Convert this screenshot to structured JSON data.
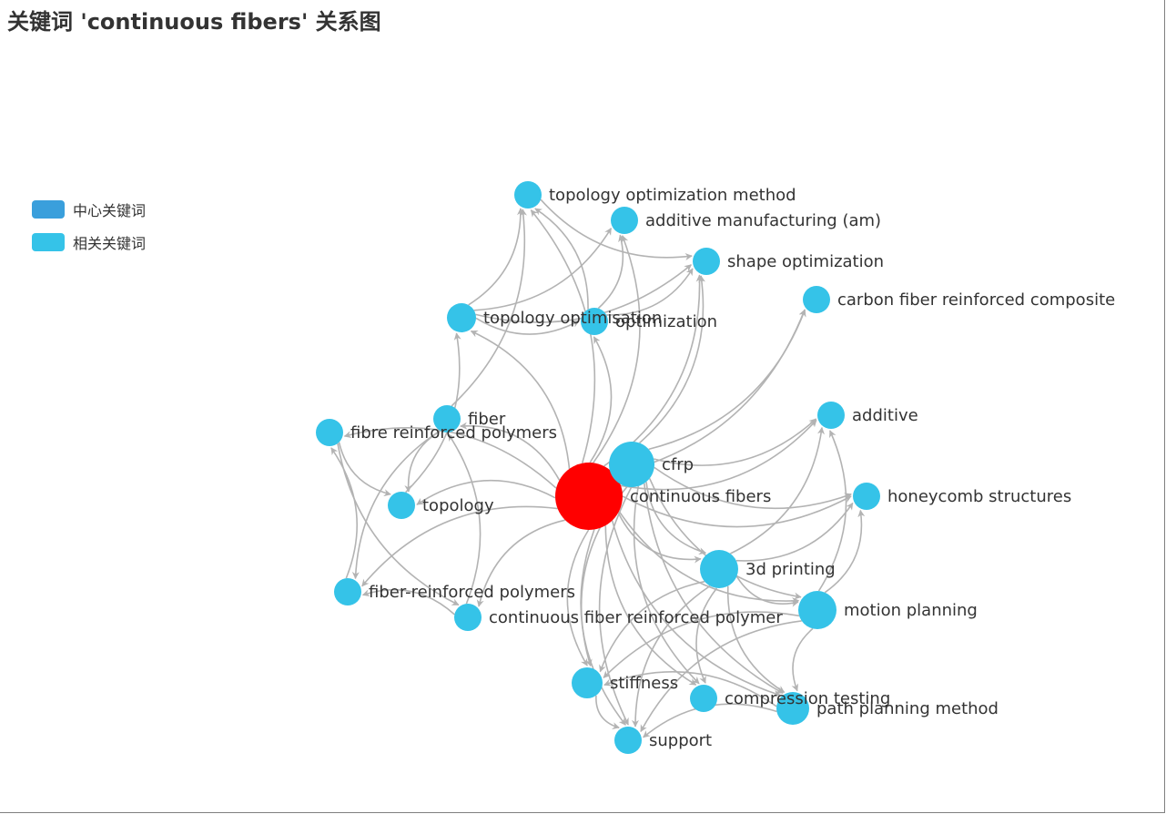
{
  "title": "关键词 'continuous fibers' 关系图",
  "legend": [
    {
      "label": "中心关键词",
      "color": "#3a9fdc"
    },
    {
      "label": "相关关键词",
      "color": "#35c3e8"
    }
  ],
  "colors": {
    "center": "#ff0000",
    "related": "#35c3e8",
    "edge": "#b3b3b3"
  },
  "nodes": [
    {
      "id": "continuous fibers",
      "category": "center"
    },
    {
      "id": "cfrp",
      "category": "related"
    },
    {
      "id": "3d printing",
      "category": "related"
    },
    {
      "id": "motion planning",
      "category": "related"
    },
    {
      "id": "path planning method",
      "category": "related"
    },
    {
      "id": "topology optimization method",
      "category": "related"
    },
    {
      "id": "additive manufacturing (am)",
      "category": "related"
    },
    {
      "id": "shape optimization",
      "category": "related"
    },
    {
      "id": "carbon fiber reinforced composite",
      "category": "related"
    },
    {
      "id": "topology optimisation",
      "category": "related"
    },
    {
      "id": "optimization",
      "category": "related"
    },
    {
      "id": "additive",
      "category": "related"
    },
    {
      "id": "fiber",
      "category": "related"
    },
    {
      "id": "fibre reinforced polymers",
      "category": "related"
    },
    {
      "id": "honeycomb structures",
      "category": "related"
    },
    {
      "id": "topology",
      "category": "related"
    },
    {
      "id": "fiber-reinforced polymers",
      "category": "related"
    },
    {
      "id": "continuous fiber reinforced polymer",
      "category": "related"
    },
    {
      "id": "stiffness",
      "category": "related"
    },
    {
      "id": "compression testing",
      "category": "related"
    },
    {
      "id": "support",
      "category": "related"
    }
  ],
  "edges": [
    [
      "continuous fibers",
      "cfrp"
    ],
    [
      "continuous fibers",
      "3d printing"
    ],
    [
      "continuous fibers",
      "motion planning"
    ],
    [
      "continuous fibers",
      "path planning method"
    ],
    [
      "continuous fibers",
      "topology optimization method"
    ],
    [
      "continuous fibers",
      "additive manufacturing (am)"
    ],
    [
      "continuous fibers",
      "shape optimization"
    ],
    [
      "continuous fibers",
      "carbon fiber reinforced composite"
    ],
    [
      "continuous fibers",
      "topology optimisation"
    ],
    [
      "continuous fibers",
      "optimization"
    ],
    [
      "continuous fibers",
      "additive"
    ],
    [
      "continuous fibers",
      "fiber"
    ],
    [
      "continuous fibers",
      "fibre reinforced polymers"
    ],
    [
      "continuous fibers",
      "honeycomb structures"
    ],
    [
      "continuous fibers",
      "topology"
    ],
    [
      "continuous fibers",
      "fiber-reinforced polymers"
    ],
    [
      "continuous fibers",
      "continuous fiber reinforced polymer"
    ],
    [
      "continuous fibers",
      "stiffness"
    ],
    [
      "continuous fibers",
      "compression testing"
    ],
    [
      "continuous fibers",
      "support"
    ],
    [
      "cfrp",
      "additive"
    ],
    [
      "cfrp",
      "honeycomb structures"
    ],
    [
      "cfrp",
      "carbon fiber reinforced composite"
    ],
    [
      "cfrp",
      "shape optimization"
    ],
    [
      "cfrp",
      "3d printing"
    ],
    [
      "cfrp",
      "motion planning"
    ],
    [
      "cfrp",
      "path planning method"
    ],
    [
      "cfrp",
      "stiffness"
    ],
    [
      "cfrp",
      "support"
    ],
    [
      "cfrp",
      "compression testing"
    ],
    [
      "3d printing",
      "additive"
    ],
    [
      "3d printing",
      "honeycomb structures"
    ],
    [
      "3d printing",
      "motion planning"
    ],
    [
      "3d printing",
      "path planning method"
    ],
    [
      "3d printing",
      "stiffness"
    ],
    [
      "3d printing",
      "support"
    ],
    [
      "3d printing",
      "compression testing"
    ],
    [
      "motion planning",
      "path planning method"
    ],
    [
      "motion planning",
      "honeycomb structures"
    ],
    [
      "motion planning",
      "additive"
    ],
    [
      "motion planning",
      "stiffness"
    ],
    [
      "motion planning",
      "support"
    ],
    [
      "path planning method",
      "support"
    ],
    [
      "path planning method",
      "stiffness"
    ],
    [
      "topology optimisation",
      "topology optimization method"
    ],
    [
      "topology optimisation",
      "additive manufacturing (am)"
    ],
    [
      "topology optimisation",
      "shape optimization"
    ],
    [
      "topology optimisation",
      "optimization"
    ],
    [
      "optimization",
      "topology optimization method"
    ],
    [
      "optimization",
      "shape optimization"
    ],
    [
      "optimization",
      "additive manufacturing (am)"
    ],
    [
      "topology optimization method",
      "shape optimization"
    ],
    [
      "fiber",
      "topology optimization method"
    ],
    [
      "fiber",
      "topology"
    ],
    [
      "fiber",
      "fiber-reinforced polymers"
    ],
    [
      "fibre reinforced polymers",
      "continuous fiber reinforced polymer"
    ],
    [
      "fibre reinforced polymers",
      "topology"
    ],
    [
      "fiber-reinforced polymers",
      "fibre reinforced polymers"
    ],
    [
      "continuous fiber reinforced polymer",
      "fiber-reinforced polymers"
    ],
    [
      "continuous fiber reinforced polymer",
      "fiber"
    ],
    [
      "topology",
      "topology optimisation"
    ],
    [
      "stiffness",
      "support"
    ]
  ]
}
